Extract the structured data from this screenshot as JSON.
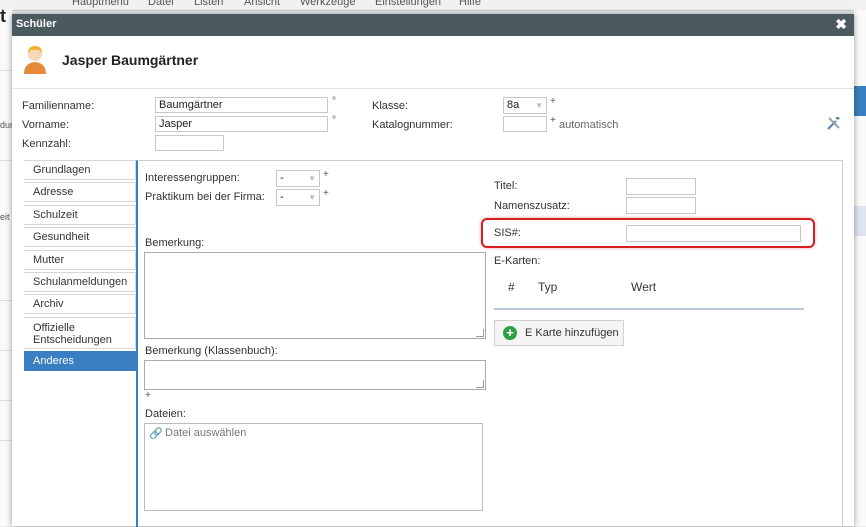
{
  "app": {
    "logo": "t",
    "menu": [
      "Hauptmenü",
      "Datei",
      "Listen",
      "Ansicht",
      "Werkzeuge",
      "Einstellungen",
      "Hilfe"
    ],
    "left_fragments": [
      "dur",
      "eit"
    ]
  },
  "dialog": {
    "title": "Schüler",
    "close_label": "✖",
    "student_name": "Jasper Baumgärtner"
  },
  "form": {
    "familienname_label": "Familienname:",
    "familienname_value": "Baumgärtner",
    "vorname_label": "Vorname:",
    "vorname_value": "Jasper",
    "kennzahl_label": "Kennzahl:",
    "kennzahl_value": "",
    "klasse_label": "Klasse:",
    "klasse_value": "8a",
    "katalognummer_label": "Katalognummer:",
    "katalognummer_value": "",
    "automatisch_label": "automatisch",
    "required_mark": "°",
    "plus_mark": "+"
  },
  "nav": {
    "items": [
      {
        "label": "Grundlagen"
      },
      {
        "label": "Adresse"
      },
      {
        "label": "Schulzeit"
      },
      {
        "label": "Gesundheit"
      },
      {
        "label": "Mutter"
      },
      {
        "label": "Schulanmeldungen"
      },
      {
        "label": "Archiv"
      },
      {
        "label": "Offizielle Entscheidungen"
      },
      {
        "label": "Anderes"
      }
    ],
    "active": "Anderes"
  },
  "anderes": {
    "interessengruppen_label": "Interessengruppen:",
    "interessengruppen_value": "-",
    "praktikum_label": "Praktikum bei der Firma:",
    "praktikum_value": "-",
    "bemerkung_label": "Bemerkung:",
    "bemerkung_klassenbuch_label": "Bemerkung (Klassenbuch):",
    "dateien_label": "Dateien:",
    "datei_placeholder": "Datei auswählen",
    "titel_label": "Titel:",
    "namenszusatz_label": "Namenszusatz:",
    "sis_label": "SIS#:",
    "sis_value": "",
    "ekarten_label": "E-Karten:",
    "ekarten_columns": [
      "#",
      "Typ",
      "Wert"
    ],
    "add_ekarte_label": "E Karte hinzufügen"
  },
  "colors": {
    "titlebar": "#4a5a5e",
    "accent": "#3a7fc1",
    "highlight": "#d81f1f",
    "add_icon": "#2ea043"
  }
}
